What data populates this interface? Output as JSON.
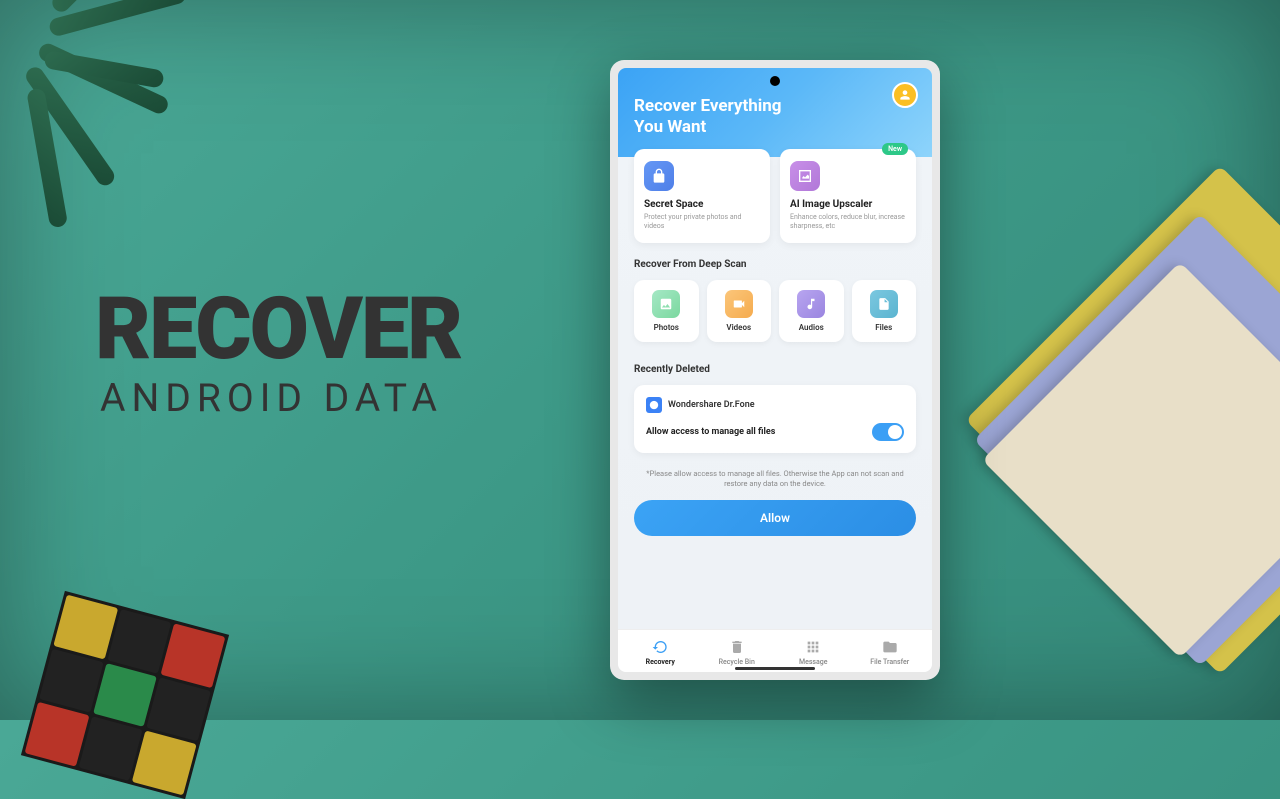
{
  "promo": {
    "main": "RECOVER",
    "sub": "ANDROID DATA"
  },
  "header": {
    "title_line1": "Recover Everything",
    "title_line2": "You Want"
  },
  "feature_cards": [
    {
      "title": "Secret Space",
      "desc": "Protect your private photos and videos",
      "badge": null
    },
    {
      "title": "AI Image Upscaler",
      "desc": "Enhance colors, reduce blur, increase sharpness, etc",
      "badge": "New"
    }
  ],
  "deep_scan": {
    "title": "Recover From Deep Scan",
    "items": [
      "Photos",
      "Videos",
      "Audios",
      "Files"
    ]
  },
  "recently_deleted": {
    "title": "Recently Deleted",
    "app_name": "Wondershare Dr.Fone",
    "permission_text": "Allow access to manage all files",
    "note": "*Please allow access to manage all files. Otherwise the App can not scan and restore any data on the device.",
    "allow_label": "Allow"
  },
  "nav": [
    "Recovery",
    "Recycle Bin",
    "Message",
    "File Transfer"
  ]
}
